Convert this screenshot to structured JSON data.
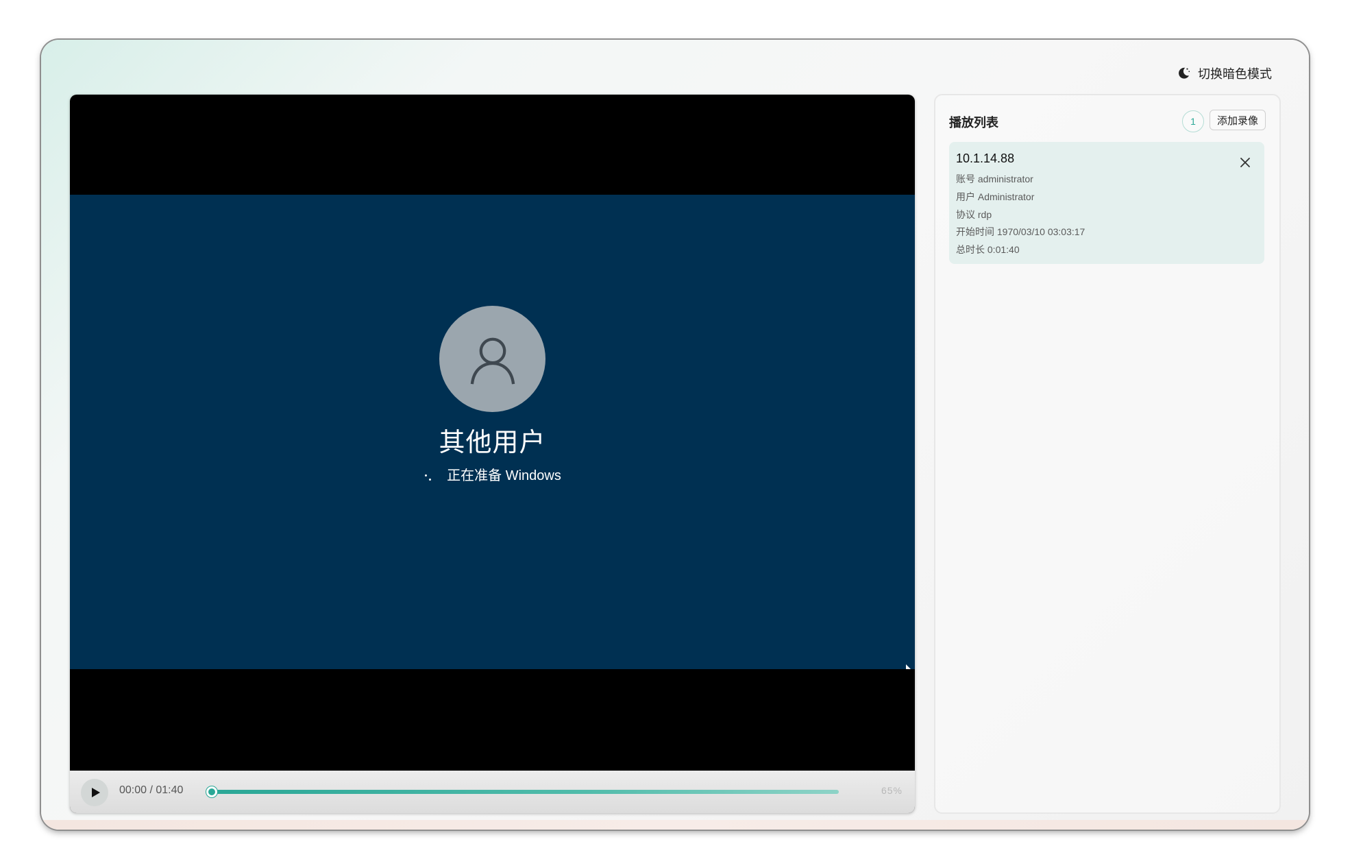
{
  "header": {
    "theme_toggle_label": "切换暗色模式",
    "theme_toggle_icon": "moon-icon"
  },
  "player": {
    "screen": {
      "user_name": "其他用户",
      "status_text": "正在准备 Windows",
      "background_color": "#003052"
    },
    "controls": {
      "play_icon": "play-icon",
      "time_readout": "00:00 / 01:40",
      "progress_fraction": 0.01,
      "volume_label": "65%",
      "accent_color": "#2aa796"
    }
  },
  "playlist": {
    "title": "播放列表",
    "count": "1",
    "add_button_label": "添加录像",
    "items": [
      {
        "host": "10.1.14.88",
        "account": "账号 administrator",
        "user": "用户 Administrator",
        "protocol": "协议 rdp",
        "start_time": "开始时间 1970/03/10 03:03:17",
        "duration": "总时长 0:01:40",
        "close_icon": "close-icon"
      }
    ]
  }
}
